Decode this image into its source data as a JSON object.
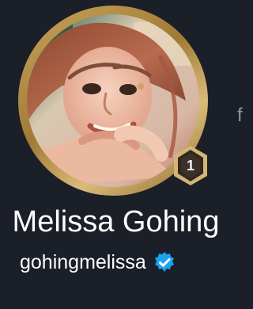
{
  "profile": {
    "display_name": "Melissa Gohing",
    "username": "gohingmelissa",
    "rank": "1",
    "side_letter": "f"
  },
  "icons": {
    "avatar": "avatar-photo",
    "rank_badge": "rank-badge-icon",
    "verified": "verified-icon"
  },
  "colors": {
    "background": "#1b1f27",
    "ring_gold": "#c9a45b",
    "verified_blue": "#1da1f2",
    "badge_dark": "#2f2a25"
  }
}
